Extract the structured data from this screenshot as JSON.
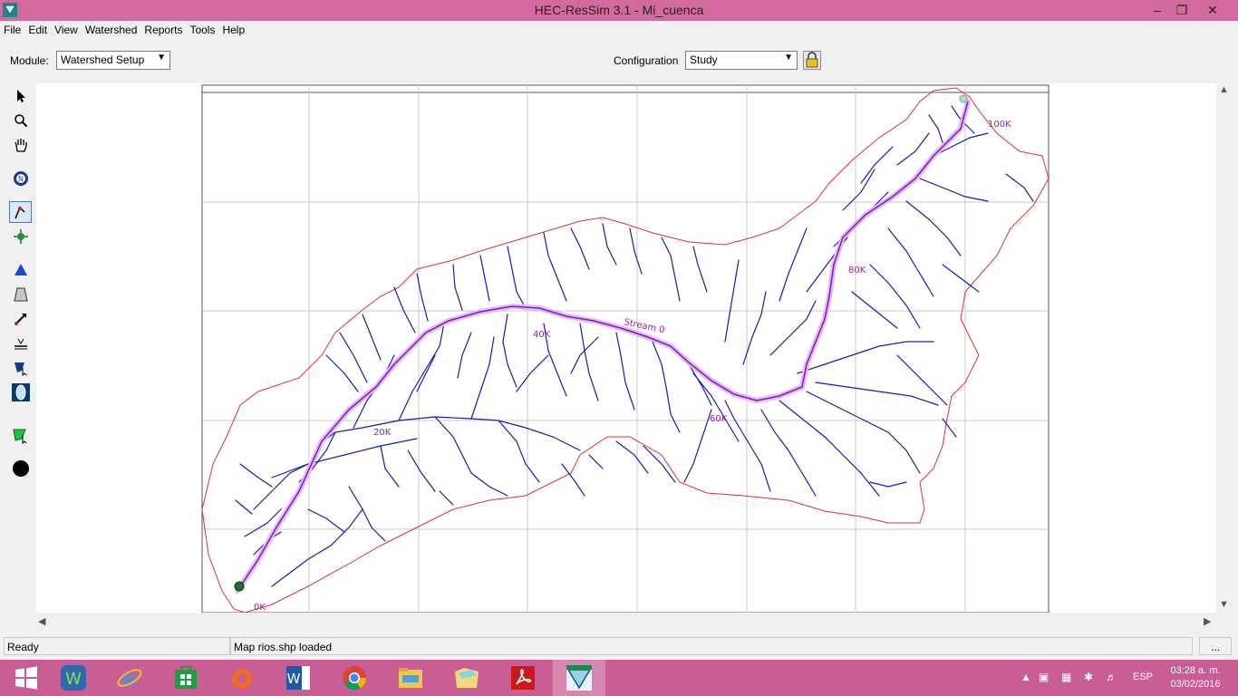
{
  "window": {
    "title": "HEC-ResSim 3.1  - Mi_cuenca",
    "controls": [
      "–",
      "❐",
      "✕"
    ]
  },
  "menu": [
    "File",
    "Edit",
    "View",
    "Watershed",
    "Reports",
    "Tools",
    "Help"
  ],
  "module": {
    "label": "Module:",
    "value": "Watershed Setup"
  },
  "configuration": {
    "label": "Configuration",
    "value": "Study"
  },
  "tools": [
    {
      "name": "select-arrow-icon"
    },
    {
      "name": "zoom-icon"
    },
    {
      "name": "pan-hand-icon"
    },
    {
      "name": "north-arrow-icon"
    },
    {
      "name": "stream-alignment-icon",
      "active": true
    },
    {
      "name": "junction-icon"
    },
    {
      "name": "reservoir-icon"
    },
    {
      "name": "dam-icon"
    },
    {
      "name": "diversion-icon"
    },
    {
      "name": "reach-icon"
    },
    {
      "name": "impact-area-icon"
    },
    {
      "name": "gage-icon"
    },
    {
      "name": "computation-point-icon"
    },
    {
      "name": "point-icon"
    }
  ],
  "map": {
    "labels": {
      "k0": "0K",
      "k20": "20K",
      "k40": "40K",
      "k60": "60K",
      "k80": "80K",
      "k100": "100K",
      "stream": "Stream 0"
    },
    "colors": {
      "boundary": "#e03030",
      "streams": "#1a1ab8",
      "main_stream": "#b23ad6",
      "grid": "#c8c8c8"
    }
  },
  "status": {
    "left": "Ready",
    "message": "Map rios.shp loaded",
    "button": "..."
  },
  "taskbar": {
    "apps": [
      "start-icon",
      "wps-icon",
      "internet-explorer-icon",
      "store-icon",
      "origin-icon",
      "word-icon",
      "chrome-icon",
      "file-explorer-icon",
      "folder-icon",
      "acrobat-icon",
      "ressim-icon"
    ],
    "lang": "ESP",
    "time": "03:28 a. m.",
    "date": "03/02/2016"
  }
}
